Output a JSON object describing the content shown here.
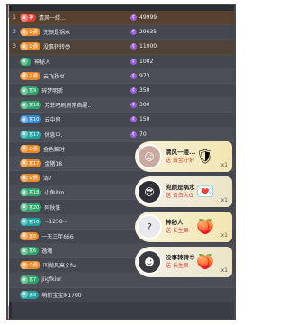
{
  "leaderboard": [
    {
      "rank": "1",
      "badge": "神",
      "badge_color": "red",
      "name": "清风一缕...",
      "score": "49999",
      "tone": "top1"
    },
    {
      "rank": "2",
      "badge": "公爵",
      "badge_color": "orange",
      "name": "兜颜是祸水",
      "score": "29635",
      "tone": "top2"
    },
    {
      "rank": "3",
      "badge": "公爵",
      "badge_color": "orange",
      "name": "没事转转😎",
      "score": "11000",
      "tone": "top3"
    },
    {
      "rank": "",
      "badge": "",
      "badge_color": "green",
      "name": "神秘人",
      "score": "1002",
      "tone": ""
    },
    {
      "rank": "",
      "badge": "子爵",
      "badge_color": "orange",
      "name": "云飞扬ゼ",
      "score": "973",
      "tone": ""
    },
    {
      "rank": "",
      "badge": "富9",
      "badge_color": "green",
      "name": "碎梦明昕",
      "score": "350",
      "tone": ""
    },
    {
      "rank": "",
      "badge": "富16",
      "badge_color": "green",
      "name": "芳菲吧刷刷常自醒..",
      "score": "300",
      "tone": ""
    },
    {
      "rank": "",
      "badge": "富10",
      "badge_color": "blue",
      "name": "云中留",
      "score": "150",
      "tone": ""
    },
    {
      "rank": "",
      "badge": "富17",
      "badge_color": "teal",
      "name": "休息中.",
      "score": "70",
      "tone": ""
    },
    {
      "rank": "",
      "badge": "公爵",
      "badge_color": "orange",
      "name": "金色麟时",
      "score": "",
      "tone": ""
    },
    {
      "rank": "",
      "badge": "富17",
      "badge_color": "orange",
      "name": "金猪18",
      "score": "",
      "tone": ""
    },
    {
      "rank": "",
      "badge": "公爵",
      "badge_color": "orange",
      "name": "清7",
      "score": "",
      "tone": ""
    },
    {
      "rank": "",
      "badge": "富18",
      "badge_color": "green",
      "name": "小鱼itm",
      "score": "",
      "tone": ""
    },
    {
      "rank": "",
      "badge": "富20",
      "badge_color": "green",
      "name": "阿秋狂",
      "score": "",
      "tone": ""
    },
    {
      "rank": "",
      "badge": "富10",
      "badge_color": "teal",
      "name": "~1258~",
      "score": "",
      "tone": ""
    },
    {
      "rank": "",
      "badge": "富6",
      "badge_color": "orange",
      "name": "一天三年666",
      "score": "",
      "tone": ""
    },
    {
      "rank": "",
      "badge": "富6",
      "badge_color": "green",
      "name": "逸魂",
      "score": "",
      "tone": ""
    },
    {
      "rank": "",
      "badge": "公爵",
      "badge_color": "orange",
      "name": "叫抛风高彡fu",
      "score": "",
      "tone": ""
    },
    {
      "rank": "",
      "badge": "富7",
      "badge_color": "green",
      "name": "jiigfkiur",
      "score": "",
      "tone": ""
    },
    {
      "rank": "",
      "badge": "富8",
      "badge_color": "teal",
      "name": "萌新宝宝lk1700",
      "score": "",
      "tone": ""
    }
  ],
  "gifts": [
    {
      "sender": "清风一缕...",
      "desc": "送 黄金守护",
      "count": "x1",
      "icon": "gold-shield-icon",
      "glyph": "🛡",
      "avatar": "girl"
    },
    {
      "sender": "兜颜是祸水",
      "desc": "送 告白大G",
      "count": "x1",
      "icon": "heart-letter-icon",
      "glyph": "💌",
      "avatar": "sunglasses"
    },
    {
      "sender": "神秘人",
      "desc": "送 长生果",
      "count": "x1",
      "icon": "peach-icon",
      "glyph": "🍑",
      "avatar": "mystery"
    },
    {
      "sender": "没事转转😎",
      "desc": "送 长生果",
      "count": "x1",
      "icon": "peach-icon",
      "glyph": "🍑",
      "avatar": "guy"
    }
  ],
  "colors": {
    "accent": "#f2a23a",
    "panel": "#3b3d46",
    "coin": "#9b5ce0",
    "gift_text": "#e2463b"
  }
}
